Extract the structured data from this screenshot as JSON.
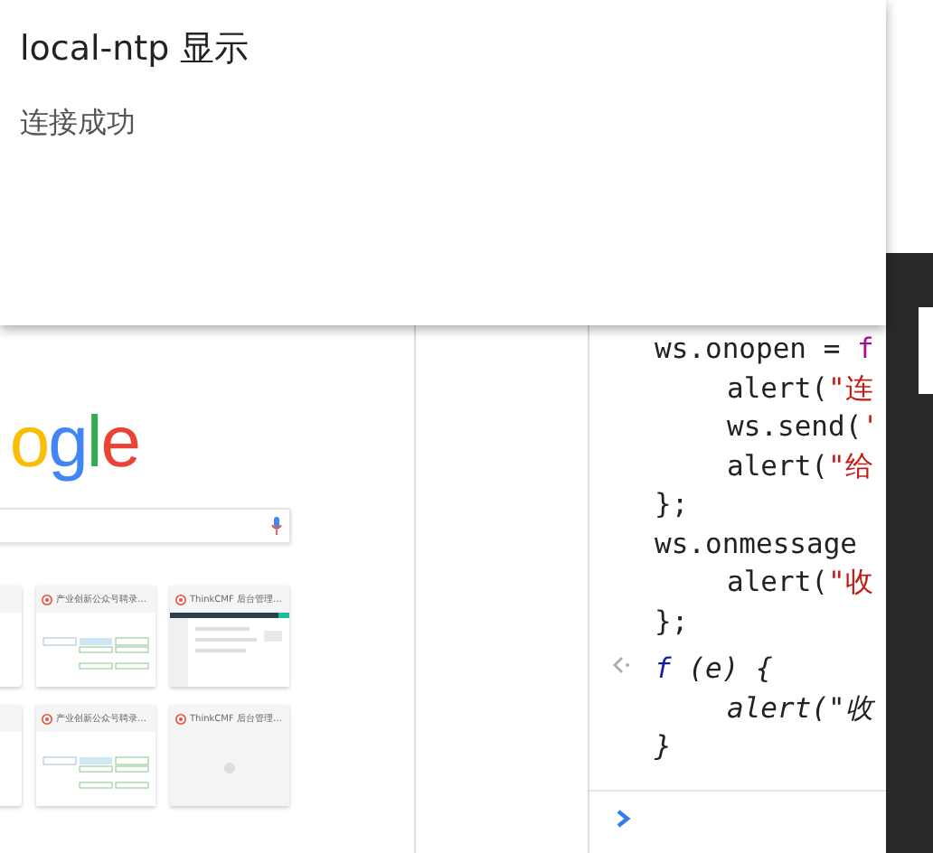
{
  "alert_dialog": {
    "title": "local-ntp 显示",
    "message": "连接成功"
  },
  "new_tab_page": {
    "logo": "ogle",
    "tiles": [
      {
        "kind": "partial"
      },
      {
        "title": "产业创新公众号聘录…",
        "kind": "diagram"
      },
      {
        "title": "ThinkCMF 后台管理…",
        "kind": "admin"
      },
      {
        "kind": "partial"
      },
      {
        "title": "产业创新公众号聘录…",
        "kind": "diagram"
      },
      {
        "title": "ThinkCMF 后台管理…",
        "kind": "blank"
      }
    ]
  },
  "console": {
    "lines": [
      {
        "kind": "input",
        "indent": false,
        "segments": [
          {
            "text": "ws.onopen = ",
            "kind": "plain"
          },
          {
            "text": "f",
            "kind": "keyword"
          }
        ]
      },
      {
        "kind": "input",
        "indent": true,
        "segments": [
          {
            "text": "alert(",
            "kind": "plain"
          },
          {
            "text": "\"连",
            "kind": "string"
          }
        ]
      },
      {
        "kind": "input",
        "indent": true,
        "segments": [
          {
            "text": "ws.send(",
            "kind": "plain"
          },
          {
            "text": "'",
            "kind": "string"
          }
        ]
      },
      {
        "kind": "input",
        "indent": true,
        "segments": [
          {
            "text": "alert(",
            "kind": "plain"
          },
          {
            "text": "\"给",
            "kind": "string"
          }
        ]
      },
      {
        "kind": "input",
        "indent": false,
        "segments": [
          {
            "text": "};",
            "kind": "plain"
          }
        ]
      },
      {
        "kind": "input",
        "indent": false,
        "segments": [
          {
            "text": "ws.onmessage",
            "kind": "plain"
          }
        ]
      },
      {
        "kind": "input",
        "indent": true,
        "segments": [
          {
            "text": "alert(",
            "kind": "plain"
          },
          {
            "text": "\"收",
            "kind": "string"
          }
        ]
      },
      {
        "kind": "input",
        "indent": false,
        "segments": [
          {
            "text": "};",
            "kind": "plain"
          }
        ]
      },
      {
        "kind": "result",
        "indent": false,
        "segments": [
          {
            "text": "f",
            "kind": "keyword"
          },
          {
            "text": " (e) {",
            "kind": "plain"
          }
        ]
      },
      {
        "kind": "result-cont",
        "indent": true,
        "segments": [
          {
            "text": "alert(\"收",
            "kind": "plain"
          }
        ]
      },
      {
        "kind": "result-cont",
        "indent": false,
        "segments": [
          {
            "text": "}",
            "kind": "plain"
          }
        ]
      }
    ]
  }
}
